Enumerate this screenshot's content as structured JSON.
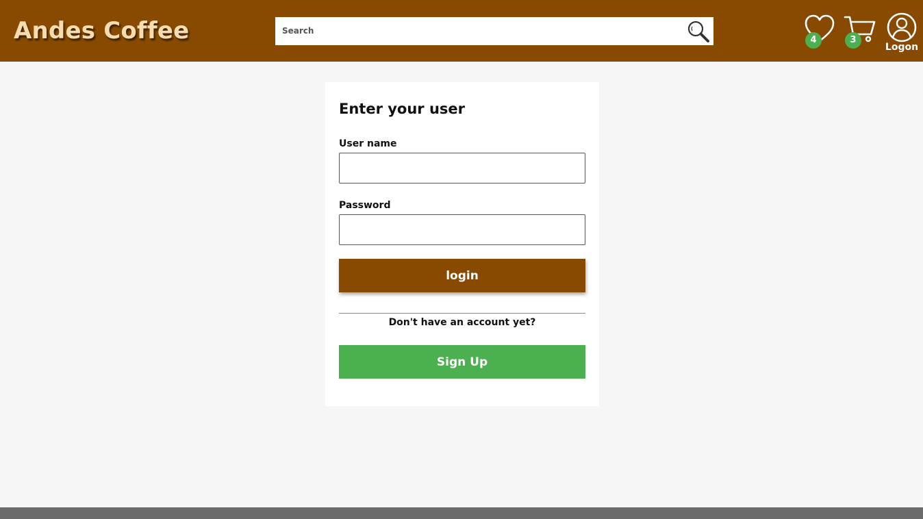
{
  "header": {
    "brand": "Andes Coffee",
    "search_placeholder": "Search",
    "favorites_count": "4",
    "cart_count": "3",
    "logon_label": "Logon"
  },
  "login_form": {
    "title": "Enter your user",
    "username_label": "User name",
    "username_value": "",
    "password_label": "Password",
    "password_value": "",
    "login_button": "login",
    "no_account_text": "Don't have an account yet?",
    "signup_button": "Sign Up"
  },
  "colors": {
    "header_bg": "#874a00",
    "brand_text": "#f7dcb0",
    "badge": "#4caf50",
    "login_button": "#874a00",
    "signup_button": "#4caf50",
    "page_bg": "#f6f6f6",
    "footer": "#6b6b6b"
  },
  "icons": {
    "search": "search-icon",
    "favorites": "heart-icon",
    "cart": "cart-icon",
    "user": "user-circle-icon"
  }
}
